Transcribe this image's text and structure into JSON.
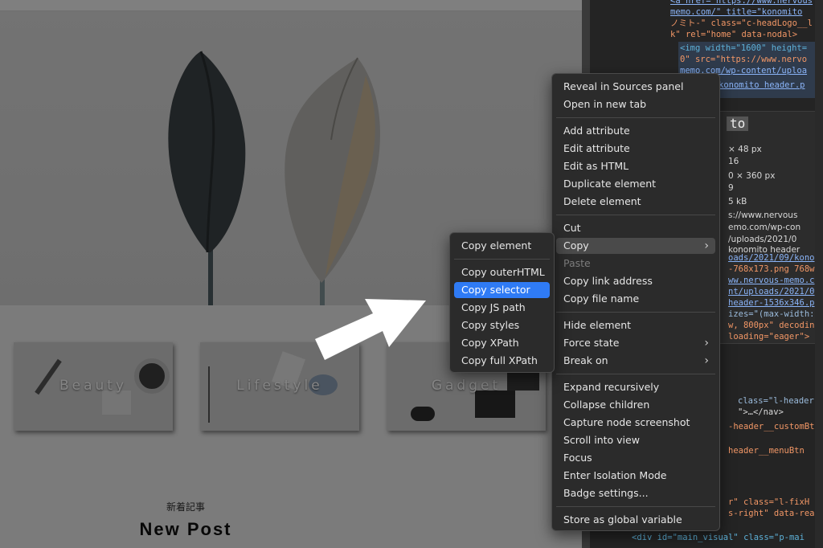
{
  "webpage": {
    "categories": [
      "Beauty",
      "Lifestyle",
      "Gadget"
    ],
    "news_subtitle": "新着記事",
    "news_title": "New Post"
  },
  "devtools": {
    "lines": [
      "<a href= https://www.nervous",
      "memo.com/\" title=\"konomito",
      "ノミト-\" class=\"c-headLogo__l",
      "k\" rel=\"home\" data-nodal>",
      "<img width=\"1600\" height=",
      "0\" src=\"https://www.nervo",
      "memo.com/wp-content/uploa",
      "konomito header.p",
      "to",
      "× 48 px",
      "16",
      "0 × 360 px",
      "9",
      "5 kB",
      "s://www.nervous",
      "emo.com/wp-con",
      "/uploads/2021/0",
      "konomito header",
      "oads/2021/09/kono",
      "-768x173.png 768w",
      "ww.nervous-memo.c",
      "nt/uploads/2021/0",
      "header-1536x346.p",
      "izes=\"(max-width:",
      "w, 800px\" decodin",
      "loading=\"eager\">",
      "class=\"l-header",
      "\">…</nav>",
      "-header__customBt",
      "header__menuBtn",
      "r\" class=\"l-fixH",
      "s-right\" data-rea",
      "<div id=\"main_visual\" class=\"p-mai"
    ]
  },
  "context_menu": {
    "items": [
      {
        "label": "Reveal in Sources panel"
      },
      {
        "label": "Open in new tab"
      },
      {
        "label": "Add attribute"
      },
      {
        "label": "Edit attribute"
      },
      {
        "label": "Edit as HTML"
      },
      {
        "label": "Duplicate element"
      },
      {
        "label": "Delete element"
      },
      {
        "label": "Cut"
      },
      {
        "label": "Copy",
        "submenu": true
      },
      {
        "label": "Paste",
        "disabled": true
      },
      {
        "label": "Copy link address"
      },
      {
        "label": "Copy file name"
      },
      {
        "label": "Hide element"
      },
      {
        "label": "Force state",
        "submenu": true
      },
      {
        "label": "Break on",
        "submenu": true
      },
      {
        "label": "Expand recursively"
      },
      {
        "label": "Collapse children"
      },
      {
        "label": "Capture node screenshot"
      },
      {
        "label": "Scroll into view"
      },
      {
        "label": "Focus"
      },
      {
        "label": "Enter Isolation Mode"
      },
      {
        "label": "Badge settings..."
      },
      {
        "label": "Store as global variable"
      }
    ]
  },
  "copy_submenu": {
    "items": [
      {
        "label": "Copy element"
      },
      {
        "label": "Copy outerHTML"
      },
      {
        "label": "Copy selector",
        "selected": true
      },
      {
        "label": "Copy JS path"
      },
      {
        "label": "Copy styles"
      },
      {
        "label": "Copy XPath"
      },
      {
        "label": "Copy full XPath"
      }
    ]
  },
  "colors": {
    "menu_bg": "#2b2b2b",
    "highlight": "#2f7bf5",
    "hover": "#4a4a4a"
  }
}
